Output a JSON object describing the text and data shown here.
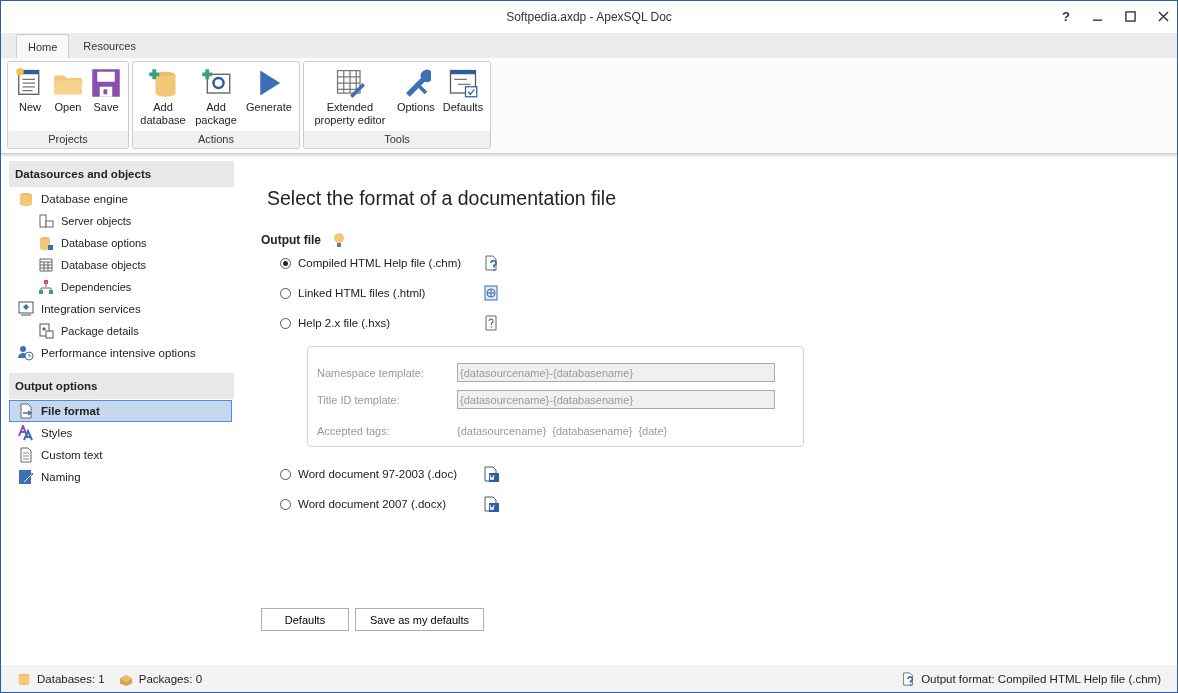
{
  "window": {
    "title": "Softpedia.axdp - ApexSQL Doc",
    "help": "?"
  },
  "tabs": [
    {
      "label": "Home",
      "selected": true
    },
    {
      "label": "Resources",
      "selected": false
    }
  ],
  "ribbon": [
    {
      "name": "Projects",
      "buttons": [
        "New",
        "Open",
        "Save"
      ]
    },
    {
      "name": "Actions",
      "buttons": [
        "Add database",
        "Add package",
        "Generate"
      ]
    },
    {
      "name": "Tools",
      "buttons": [
        "Extended property editor",
        "Options",
        "Defaults"
      ]
    }
  ],
  "sidebar": [
    {
      "title": "Datasources and objects",
      "items": [
        {
          "label": "Database engine",
          "selected": false,
          "children": [
            {
              "label": "Server objects",
              "selected": false
            },
            {
              "label": "Database options",
              "selected": false
            },
            {
              "label": "Database objects",
              "selected": false
            },
            {
              "label": "Dependencies",
              "selected": false
            }
          ]
        },
        {
          "label": "Integration services",
          "selected": false,
          "children": [
            {
              "label": "Package details",
              "selected": false
            }
          ]
        },
        {
          "label": "Performance intensive options",
          "selected": false
        }
      ]
    },
    {
      "title": "Output options",
      "items": [
        {
          "label": "File format",
          "selected": true
        },
        {
          "label": "Styles",
          "selected": false
        },
        {
          "label": "Custom text",
          "selected": false
        },
        {
          "label": "Naming",
          "selected": false
        }
      ]
    }
  ],
  "heading": "Select the format of a documentation file",
  "section": "Output file",
  "formats": [
    {
      "label": "Compiled HTML Help file (.chm)",
      "selected": true
    },
    {
      "label": "Linked HTML files (.html)",
      "selected": false
    },
    {
      "label": "Help 2.x file (.hxs)",
      "selected": false
    },
    {
      "label": "Word document 97-2003 (.doc)",
      "selected": false
    },
    {
      "label": "Word document 2007 (.docx)",
      "selected": false
    }
  ],
  "help_options": {
    "fields": [
      {
        "label": "Namespace template:",
        "value": "{datasourcename}-{databasename}"
      },
      {
        "label": "Title ID template:",
        "value": "{datasourcename}-{databasename}"
      }
    ],
    "tags_label": "Accepted tags:",
    "tags": [
      "{datasourcename}",
      "{databasename}",
      "{date}"
    ]
  },
  "buttons": [
    "Defaults",
    "Save as my defaults"
  ],
  "status_bar": {
    "databases": "Databases: 1",
    "packages": "Packages: 0",
    "output": "Output format: Compiled HTML Help file (.chm)"
  }
}
